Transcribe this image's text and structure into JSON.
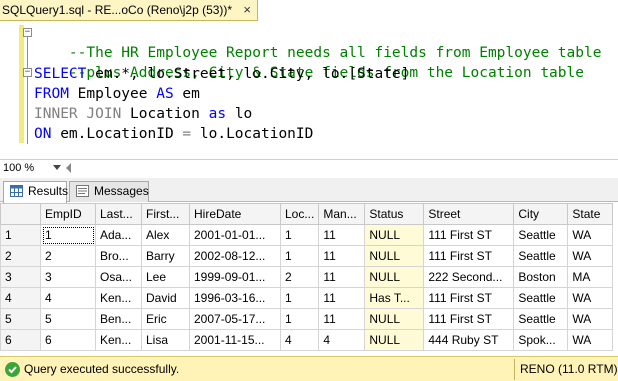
{
  "tab": {
    "title": "SQLQuery1.sql - RE...oCo (Reno\\j2p (53))*",
    "close": "×"
  },
  "editor": {
    "comment1": "--The HR Employee Report needs all fields from Employee table",
    "comment2": "--plus Address, City & State fields from the Location table",
    "line3": {
      "kw": "SELECT",
      "text": " em.*, lo.Street, lo.City, lo.[State]"
    },
    "line4": {
      "kw": "FROM",
      "text": " Employee ",
      "kw2": "AS",
      "text2": " em"
    },
    "line5": {
      "kw": "INNER JOIN",
      "text": " Location ",
      "kw2": "as",
      "text2": " lo"
    },
    "line6": {
      "kw": "ON",
      "text": " em.LocationID ",
      "op": "=",
      "text2": " lo.LocationID"
    }
  },
  "zoom": "100 %",
  "result_tabs": {
    "results": "Results",
    "messages": "Messages"
  },
  "grid": {
    "columns": [
      "",
      "EmpID",
      "Last...",
      "First...",
      "HireDate",
      "Loc...",
      "Man...",
      "Status",
      "Street",
      "City",
      "State"
    ],
    "rows": [
      [
        "1",
        "1",
        "Ada...",
        "Alex",
        "2001-01-01...",
        "1",
        "11",
        "NULL",
        "111 First ST",
        "Seattle",
        "WA"
      ],
      [
        "2",
        "2",
        "Bro...",
        "Barry",
        "2002-08-12...",
        "1",
        "11",
        "NULL",
        "111 First ST",
        "Seattle",
        "WA"
      ],
      [
        "3",
        "3",
        "Osa...",
        "Lee",
        "1999-09-01...",
        "2",
        "11",
        "NULL",
        "222 Second...",
        "Boston",
        "MA"
      ],
      [
        "4",
        "4",
        "Ken...",
        "David",
        "1996-03-16...",
        "1",
        "11",
        "Has T...",
        "111 First ST",
        "Seattle",
        "WA"
      ],
      [
        "5",
        "5",
        "Ben...",
        "Eric",
        "2007-05-17...",
        "1",
        "11",
        "NULL",
        "111 First ST",
        "Seattle",
        "WA"
      ],
      [
        "6",
        "6",
        "Ken...",
        "Lisa",
        "2001-11-15...",
        "4",
        "4",
        "NULL",
        "444 Ruby ST",
        "Spok...",
        "WA"
      ]
    ]
  },
  "status": {
    "message": "Query executed successfully.",
    "server": "RENO (11.0 RTM)"
  },
  "colors": {
    "tab_bg": "#fdf5c4",
    "status_bg": "#fff3b8",
    "keyword": "#0000ff",
    "comment": "#008000",
    "null_cell": "#fffbd6"
  }
}
